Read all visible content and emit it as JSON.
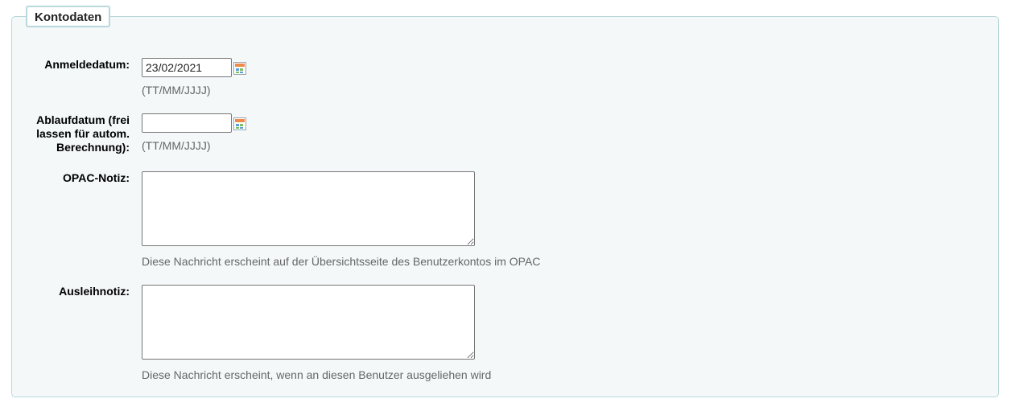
{
  "legend": "Kontodaten",
  "fields": {
    "enrolment_date": {
      "label": "Anmeldedatum:",
      "value": "23/02/2021",
      "format_hint": "(TT/MM/JJJJ)"
    },
    "expiry_date": {
      "label_lines": [
        "Ablaufdatum (frei",
        "lassen für autom.",
        "Berechnung):"
      ],
      "value": "",
      "format_hint": "(TT/MM/JJJJ)"
    },
    "opac_note": {
      "label": "OPAC-Notiz:",
      "value": "",
      "hint": "Diese Nachricht erscheint auf der Übersichtsseite des Benutzerkontos im OPAC"
    },
    "circulation_note": {
      "label": "Ausleihnotiz:",
      "value": "",
      "hint": "Diese Nachricht erscheint, wenn an diesen Benutzer ausgeliehen wird"
    }
  },
  "icons": {
    "date_picker": "calendar-icon"
  },
  "colors": {
    "fieldset_border": "#b9d8d9",
    "fieldset_bg": "#f4f8f9",
    "hint_text": "#666666"
  }
}
